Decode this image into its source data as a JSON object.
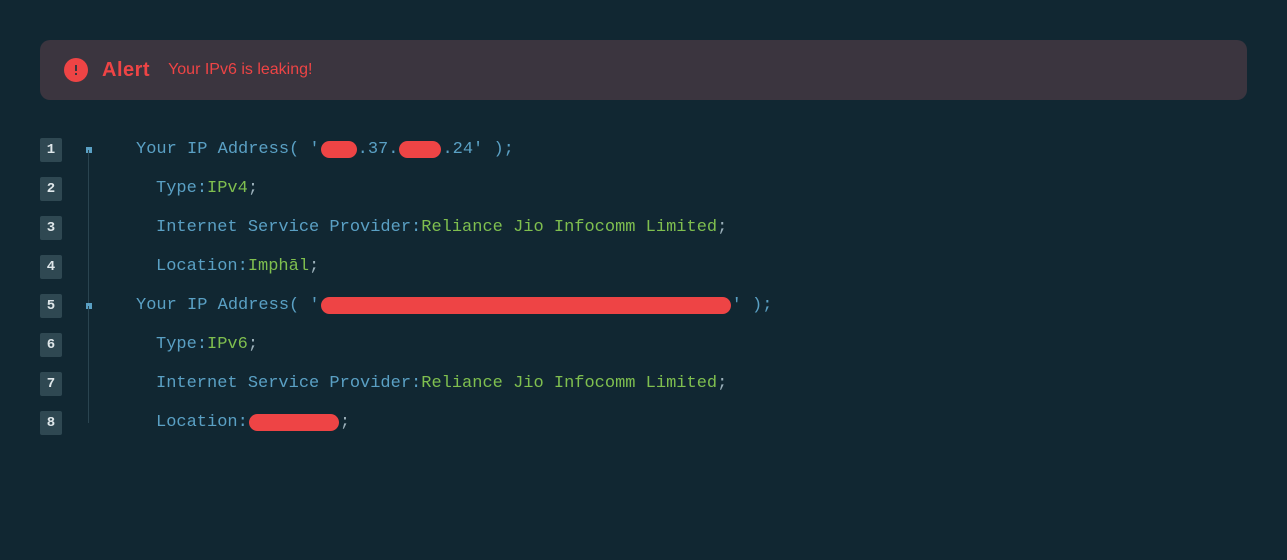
{
  "alert": {
    "title": "Alert",
    "message": "Your IPv6 is leaking!"
  },
  "lines": {
    "l1": {
      "num": "1",
      "key": "Your IP Address",
      "mid": ".37.",
      "tail": ".24' );"
    },
    "l2": {
      "num": "2",
      "key": "Type",
      "val": "IPv4"
    },
    "l3": {
      "num": "3",
      "key": "Internet Service Provider",
      "val": "Reliance Jio Infocomm Limited"
    },
    "l4": {
      "num": "4",
      "key": "Location",
      "val": "Imphāl"
    },
    "l5": {
      "num": "5",
      "key": "Your IP Address",
      "tail": "' );"
    },
    "l6": {
      "num": "6",
      "key": "Type",
      "val": "IPv6"
    },
    "l7": {
      "num": "7",
      "key": "Internet Service Provider",
      "val": "Reliance Jio Infocomm Limited"
    },
    "l8": {
      "num": "8",
      "key": "Location"
    }
  },
  "punct": {
    "open": "( '",
    "open2": "( '",
    "colon": " : ",
    "semi": " ;"
  }
}
